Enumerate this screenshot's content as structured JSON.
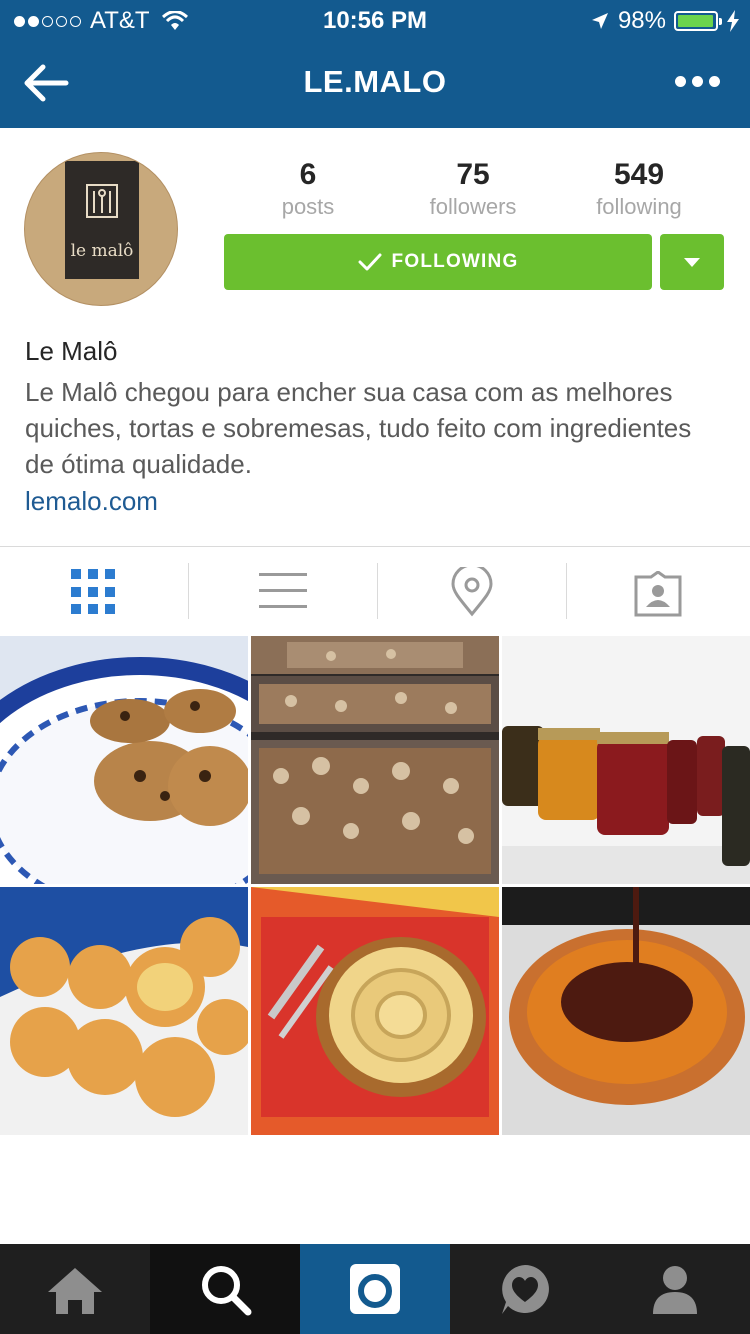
{
  "status_bar": {
    "carrier": "AT&T",
    "time": "10:56 PM",
    "battery_percent": "98%",
    "signal_bars_filled": 2,
    "signal_bars_total": 5,
    "battery_level": 0.98
  },
  "header": {
    "title": "LE.MALO"
  },
  "profile": {
    "avatar_text": "le malô",
    "stats": [
      {
        "value": "6",
        "label": "posts"
      },
      {
        "value": "75",
        "label": "followers"
      },
      {
        "value": "549",
        "label": "following"
      }
    ],
    "follow_button_label": "FOLLOWING",
    "name": "Le Malô",
    "bio": "Le Malô chegou para encher sua casa com as melhores quiches, tortas e sobremesas, tudo feito com ingredientes de ótima qualidade.",
    "link": "lemalo.com"
  },
  "tabs": [
    {
      "icon": "grid-icon",
      "active": true
    },
    {
      "icon": "list-icon",
      "active": false
    },
    {
      "icon": "location-pin-icon",
      "active": false
    },
    {
      "icon": "tagged-photos-icon",
      "active": false
    }
  ],
  "photos": [
    {
      "subject": "cookies"
    },
    {
      "subject": "walnut-bread"
    },
    {
      "subject": "jam-jars"
    },
    {
      "subject": "cheese-bread"
    },
    {
      "subject": "apple-tart"
    },
    {
      "subject": "chocolate-tart"
    }
  ],
  "bottom_nav": [
    {
      "icon": "home-icon",
      "active": false
    },
    {
      "icon": "search-icon",
      "active": false
    },
    {
      "icon": "camera-icon",
      "active": true
    },
    {
      "icon": "activity-heart-icon",
      "active": false
    },
    {
      "icon": "profile-icon",
      "active": false
    }
  ],
  "colors": {
    "header_blue": "#135a8f",
    "follow_green": "#6bbf2f",
    "link_blue": "#1f5b93",
    "active_tab_blue": "#2c7cd0"
  }
}
